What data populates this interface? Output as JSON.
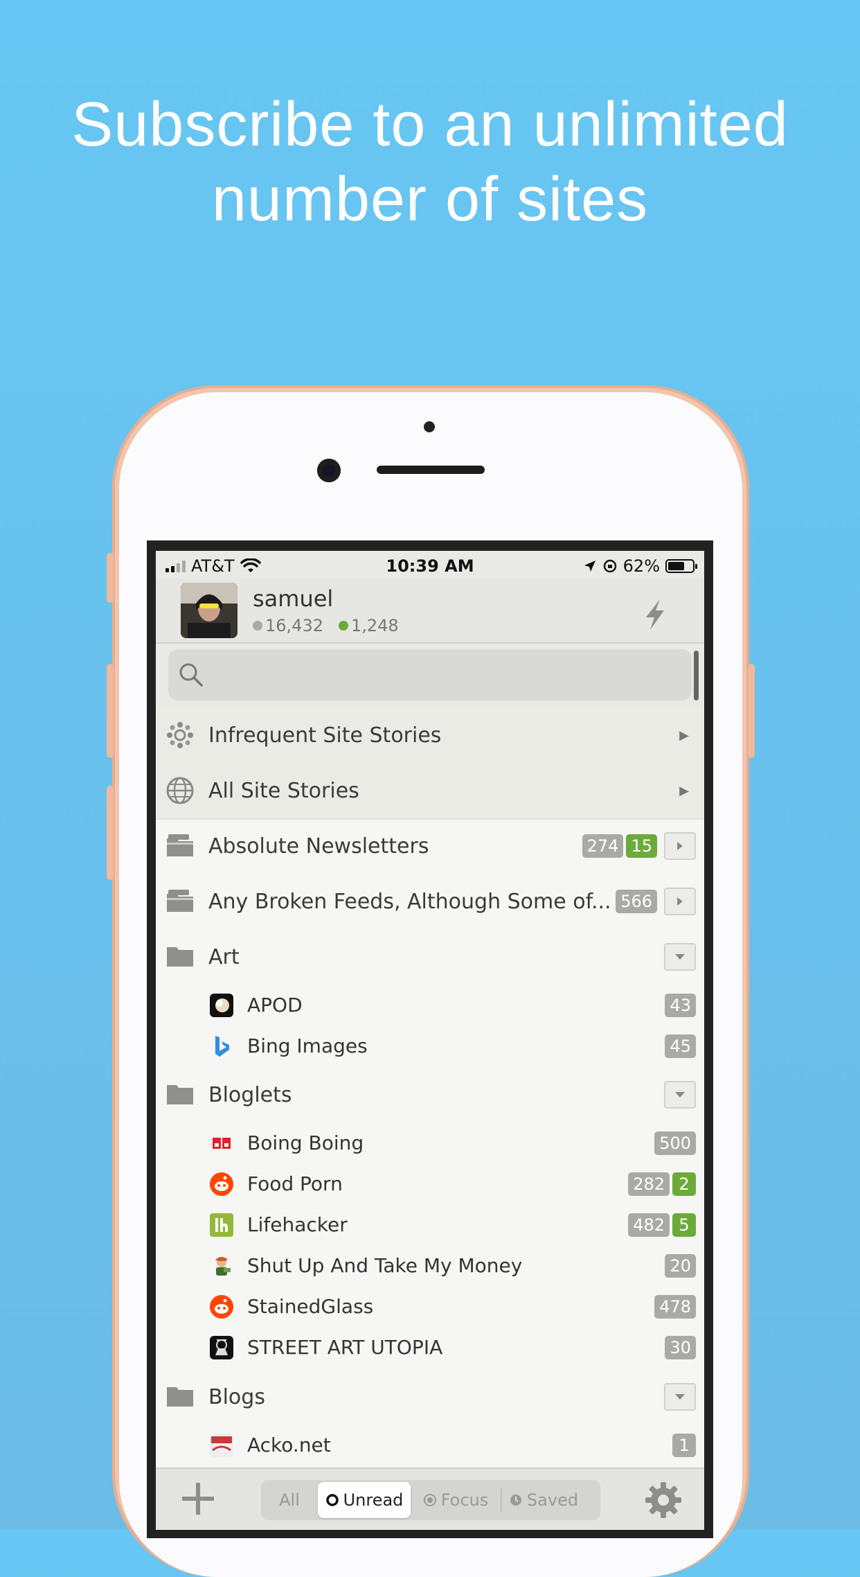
{
  "headline": {
    "line1": "Subscribe to an unlimited",
    "line2": "number of sites"
  },
  "status_bar": {
    "carrier": "AT&T",
    "time": "10:39 AM",
    "battery": "62%"
  },
  "header": {
    "username": "samuel",
    "neutral_count": "16,432",
    "positive_count": "1,248"
  },
  "search": {
    "placeholder": ""
  },
  "special_rows": [
    {
      "label": "Infrequent Site Stories",
      "icon": "infrequent-icon"
    },
    {
      "label": "All Site Stories",
      "icon": "globe-icon"
    }
  ],
  "folders": {
    "absolute_newsletters": {
      "label": "Absolute Newsletters",
      "neutral": "274",
      "positive": "15"
    },
    "broken_feeds": {
      "label": "Any Broken Feeds, Although Some of...",
      "neutral": "566"
    },
    "art": {
      "label": "Art"
    },
    "bloglets": {
      "label": "Bloglets"
    },
    "blogs": {
      "label": "Blogs"
    }
  },
  "feeds": {
    "apod": {
      "label": "APOD",
      "neutral": "43"
    },
    "bing": {
      "label": "Bing Images",
      "neutral": "45"
    },
    "boing": {
      "label": "Boing Boing",
      "neutral": "500"
    },
    "foodporn": {
      "label": "Food Porn",
      "neutral": "282",
      "positive": "2"
    },
    "lifehacker": {
      "label": "Lifehacker",
      "neutral": "482",
      "positive": "5"
    },
    "shutup": {
      "label": "Shut Up And Take My Money",
      "neutral": "20"
    },
    "stainedglass": {
      "label": "StainedGlass",
      "neutral": "478"
    },
    "streetart": {
      "label": "STREET ART UTOPIA",
      "neutral": "30"
    },
    "acko": {
      "label": "Acko.net",
      "neutral": "1"
    }
  },
  "bottom_bar": {
    "filters": [
      "All",
      "Unread",
      "Focus",
      "Saved"
    ],
    "selected": "Unread"
  },
  "colors": {
    "background": "#67c6f3",
    "positive": "#6cab3a",
    "neutral": "#a9a9a5"
  }
}
